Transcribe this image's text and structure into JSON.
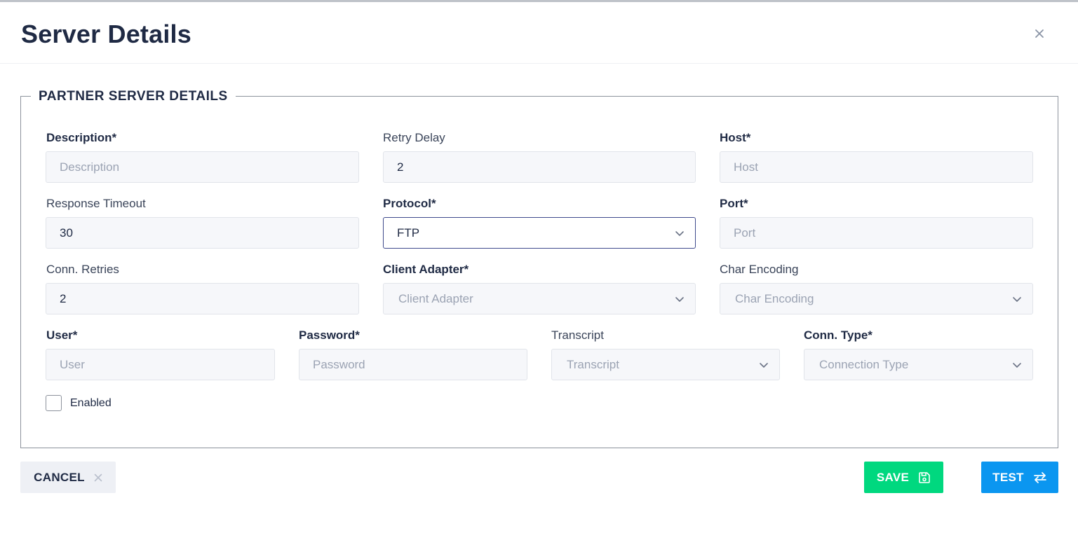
{
  "dialog": {
    "title": "Server Details"
  },
  "section": {
    "legend": "PARTNER SERVER DETAILS"
  },
  "fields": {
    "description": {
      "label": "Description*",
      "placeholder": "Description",
      "value": ""
    },
    "retry_delay": {
      "label": "Retry Delay",
      "value": "2"
    },
    "host": {
      "label": "Host*",
      "placeholder": "Host",
      "value": ""
    },
    "response_timeout": {
      "label": "Response Timeout",
      "value": "30"
    },
    "protocol": {
      "label": "Protocol*",
      "value": "FTP"
    },
    "port": {
      "label": "Port*",
      "placeholder": "Port",
      "value": ""
    },
    "conn_retries": {
      "label": "Conn. Retries",
      "value": "2"
    },
    "client_adapter": {
      "label": "Client Adapter*",
      "placeholder": "Client Adapter"
    },
    "char_encoding": {
      "label": "Char Encoding",
      "placeholder": "Char Encoding"
    },
    "user": {
      "label": "User*",
      "placeholder": "User"
    },
    "password": {
      "label": "Password*",
      "placeholder": "Password"
    },
    "transcript": {
      "label": "Transcript",
      "placeholder": "Transcript"
    },
    "conn_type": {
      "label": "Conn. Type*",
      "placeholder": "Connection Type"
    },
    "enabled": {
      "label": "Enabled",
      "checked": false
    }
  },
  "buttons": {
    "cancel": "CANCEL",
    "save": "SAVE",
    "test": "TEST"
  },
  "colors": {
    "save": "#00d87f",
    "test": "#0b96f0",
    "focus_border": "#3f4a8c"
  }
}
